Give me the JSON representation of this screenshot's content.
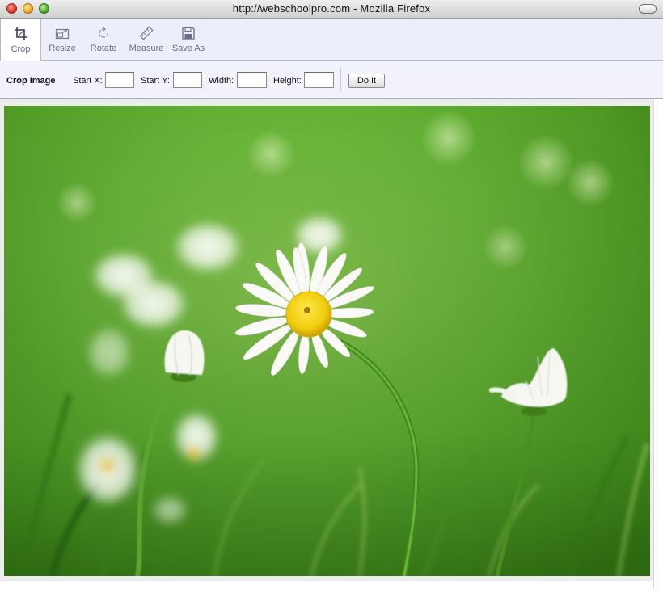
{
  "window": {
    "title": "http://webschoolpro.com - Mozilla Firefox"
  },
  "toolbar": {
    "tools": [
      {
        "label": "Crop",
        "icon": "crop-icon",
        "active": true
      },
      {
        "label": "Resize",
        "icon": "resize-icon",
        "active": false
      },
      {
        "label": "Rotate",
        "icon": "rotate-icon",
        "active": false
      },
      {
        "label": "Measure",
        "icon": "ruler-icon",
        "active": false
      },
      {
        "label": "Save As",
        "icon": "floppy-disk-icon",
        "active": false
      }
    ]
  },
  "crop": {
    "title": "Crop Image",
    "start_x_label": "Start X:",
    "start_x_value": "",
    "start_y_label": "Start Y:",
    "start_y_value": "",
    "width_label": "Width:",
    "width_value": "",
    "height_label": "Height:",
    "height_value": "",
    "submit_label": "Do It"
  },
  "colors": {
    "toolbar_bg": "#eceefa",
    "tool_text": "#6a6a8a",
    "grass_green": "#5fae2e",
    "daisy_center": "#f2d40f"
  }
}
